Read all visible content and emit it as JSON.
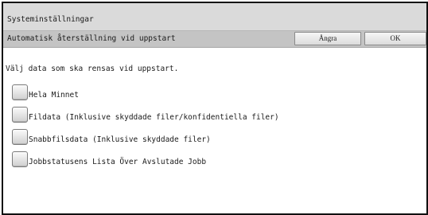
{
  "header": {
    "title": "Systeminställningar"
  },
  "subheader": {
    "title": "Automatisk återställning vid uppstart",
    "cancel_label": "Ångra",
    "ok_label": "OK"
  },
  "main": {
    "instruction": "Välj data som ska rensas vid uppstart.",
    "options": [
      {
        "label": "Hela Minnet",
        "checked": false
      },
      {
        "label": "Fildata (Inklusive skyddade filer/konfidentiella filer)",
        "checked": false
      },
      {
        "label": "Snabbfilsdata (Inklusive skyddade filer)",
        "checked": false
      },
      {
        "label": "Jobbstatusens Lista Över Avslutade Jobb",
        "checked": false
      }
    ]
  }
}
